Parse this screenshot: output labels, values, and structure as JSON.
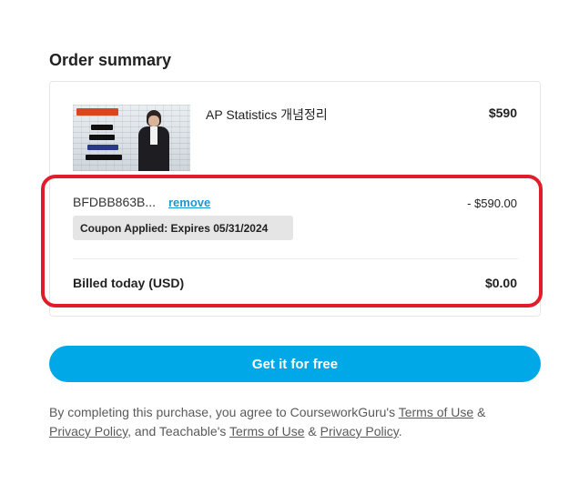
{
  "order_summary": {
    "heading": "Order summary",
    "product": {
      "title": "AP Statistics 개념정리",
      "price": "$590",
      "thumbnail_icon": "course-thumbnail-image"
    },
    "coupon": {
      "code": "BFDBB863B...",
      "remove_label": "remove",
      "discount": "- $590.00",
      "badge": "Coupon Applied: Expires 05/31/2024"
    },
    "billed": {
      "label": "Billed today (USD)",
      "amount": "$0.00"
    }
  },
  "cta": {
    "label": "Get it for free"
  },
  "legal": {
    "prefix": "By completing this purchase, you agree to CourseworkGuru's ",
    "link1": "Terms of Use",
    "amp1": " & ",
    "link2": "Privacy Policy",
    "middle": ", and Teachable's ",
    "link3": "Terms of Use",
    "amp2": " & ",
    "link4": "Privacy Policy",
    "suffix": "."
  },
  "colors": {
    "accent": "#00a8e8",
    "link": "#1b97d3",
    "highlight": "#e01e2b"
  }
}
